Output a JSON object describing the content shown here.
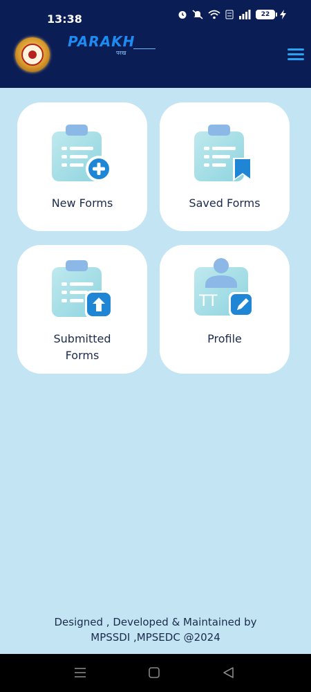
{
  "status_bar": {
    "time": "13:38",
    "battery": "22",
    "icons": [
      "alarm-icon",
      "mute-icon",
      "wifi-icon",
      "volte-icon",
      "signal-icon",
      "battery-icon",
      "charging-icon"
    ]
  },
  "header": {
    "logo_text": "PARAKH",
    "logo_subtext": "परख",
    "menu_icon": "hamburger-menu-icon"
  },
  "cards": [
    {
      "label": "New Forms",
      "icon": "clipboard-plus-icon"
    },
    {
      "label": "Saved Forms",
      "icon": "clipboard-bookmark-icon"
    },
    {
      "label_line1": "Submitted",
      "label_line2": "Forms",
      "icon": "clipboard-upload-icon"
    },
    {
      "label": "Profile",
      "icon": "profile-edit-icon"
    }
  ],
  "footer": {
    "line1": "Designed , Developed & Maintained by",
    "line2": "MPSSDI ,MPSEDC @2024"
  },
  "nav_bar": {
    "icons": [
      "recents-icon",
      "home-icon",
      "back-icon"
    ]
  },
  "colors": {
    "header_bg": "#0b1d55",
    "page_bg": "#c3e4f3",
    "accent": "#2aa3f0",
    "card_bg": "#ffffff",
    "text": "#1a2a4a"
  }
}
